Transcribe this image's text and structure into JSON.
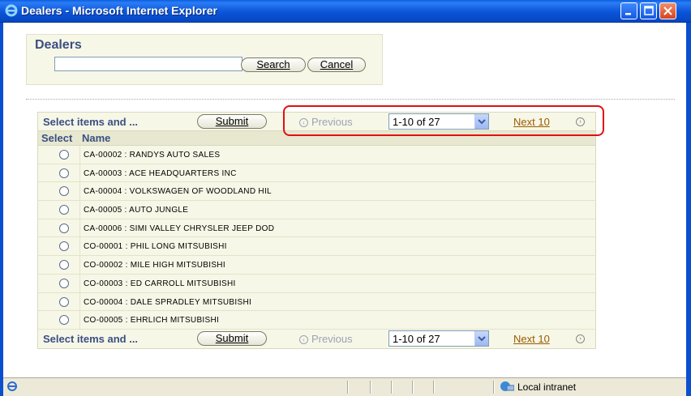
{
  "window": {
    "title": "Dealers - Microsoft Internet Explorer"
  },
  "search": {
    "heading": "Dealers",
    "value": "",
    "search_label": "Search",
    "cancel_label": "Cancel"
  },
  "toolbar": {
    "select_text": "Select items and ...",
    "submit_label": "Submit",
    "previous_label": "Previous",
    "range_value": "1-10 of 27",
    "next_label": "Next 10"
  },
  "table": {
    "columns": [
      "Select",
      "Name"
    ],
    "rows": [
      "CA-00002 : RANDYS AUTO SALES",
      "CA-00003 : ACE HEADQUARTERS INC",
      "CA-00004 : VOLKSWAGEN OF WOODLAND HIL",
      "CA-00005 : AUTO JUNGLE",
      "CA-00006 : SIMI VALLEY CHRYSLER JEEP DOD",
      "CO-00001 : PHIL LONG MITSUBISHI",
      "CO-00002 : MILE HIGH MITSUBISHI",
      "CO-00003 : ED CARROLL MITSUBISHI",
      "CO-00004 : DALE SPRADLEY MITSUBISHI",
      "CO-00005 : EHRLICH MITSUBISHI"
    ]
  },
  "status": {
    "zone": "Local intranet"
  },
  "colors": {
    "title_bar": "#0a55d8",
    "heading": "#3a4f83",
    "panel": "#f7f7e7",
    "highlight": "#e01010",
    "link": "#9a5b00"
  }
}
